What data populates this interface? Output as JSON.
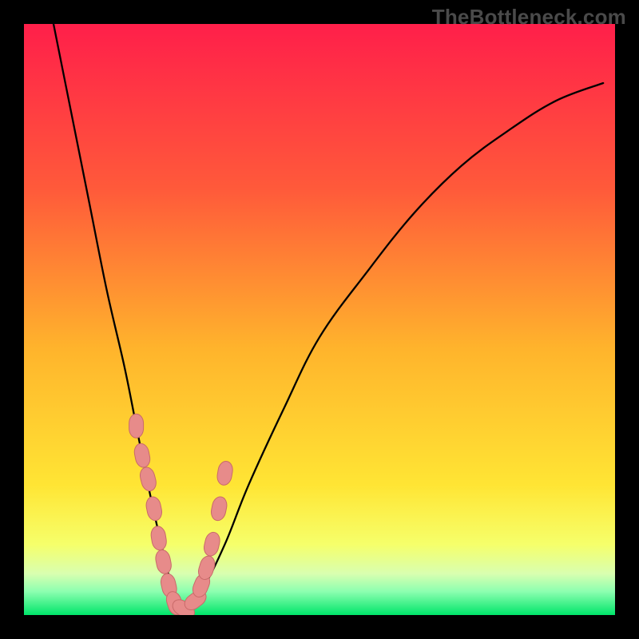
{
  "watermark": "TheBottleneck.com",
  "colors": {
    "bg_black": "#000000",
    "gradient_top": "#ff1f4a",
    "gradient_mid1": "#ff8a2a",
    "gradient_mid2": "#ffe534",
    "gradient_low": "#f6ff6a",
    "gradient_pale": "#c7ffb1",
    "gradient_green": "#00e56a",
    "curve_stroke": "#000000",
    "marker_fill": "#e78b8a",
    "marker_stroke": "#c96a69"
  },
  "chart_data": {
    "type": "line",
    "title": "",
    "xlabel": "",
    "ylabel": "",
    "xlim": [
      0,
      100
    ],
    "ylim": [
      0,
      100
    ],
    "note": "V-shaped bottleneck curve; y toward 0 (bottom / green) means optimal match; y toward 100 (top / red) means severe bottleneck. x not labeled in image.",
    "series": [
      {
        "name": "bottleneck-curve",
        "x": [
          5,
          8,
          11,
          14,
          17,
          19,
          21,
          23,
          25,
          27,
          30,
          34,
          38,
          44,
          50,
          58,
          66,
          74,
          82,
          90,
          98
        ],
        "y": [
          100,
          85,
          70,
          55,
          42,
          32,
          22,
          13,
          5,
          1,
          4,
          12,
          22,
          35,
          47,
          58,
          68,
          76,
          82,
          87,
          90
        ]
      }
    ],
    "markers": {
      "name": "highlighted-points",
      "x": [
        19.0,
        20.0,
        21.0,
        22.0,
        22.8,
        23.6,
        24.5,
        25.5,
        27.0,
        29.0,
        30.0,
        30.9,
        31.8,
        33.0,
        34.0
      ],
      "y": [
        32.0,
        27.0,
        23.0,
        18.0,
        13.0,
        9.0,
        5.0,
        2.0,
        1.0,
        2.5,
        5.0,
        8.0,
        12.0,
        18.0,
        24.0
      ]
    },
    "gradient_stops_pct": [
      0,
      28,
      55,
      78,
      88,
      93,
      96,
      100
    ]
  }
}
